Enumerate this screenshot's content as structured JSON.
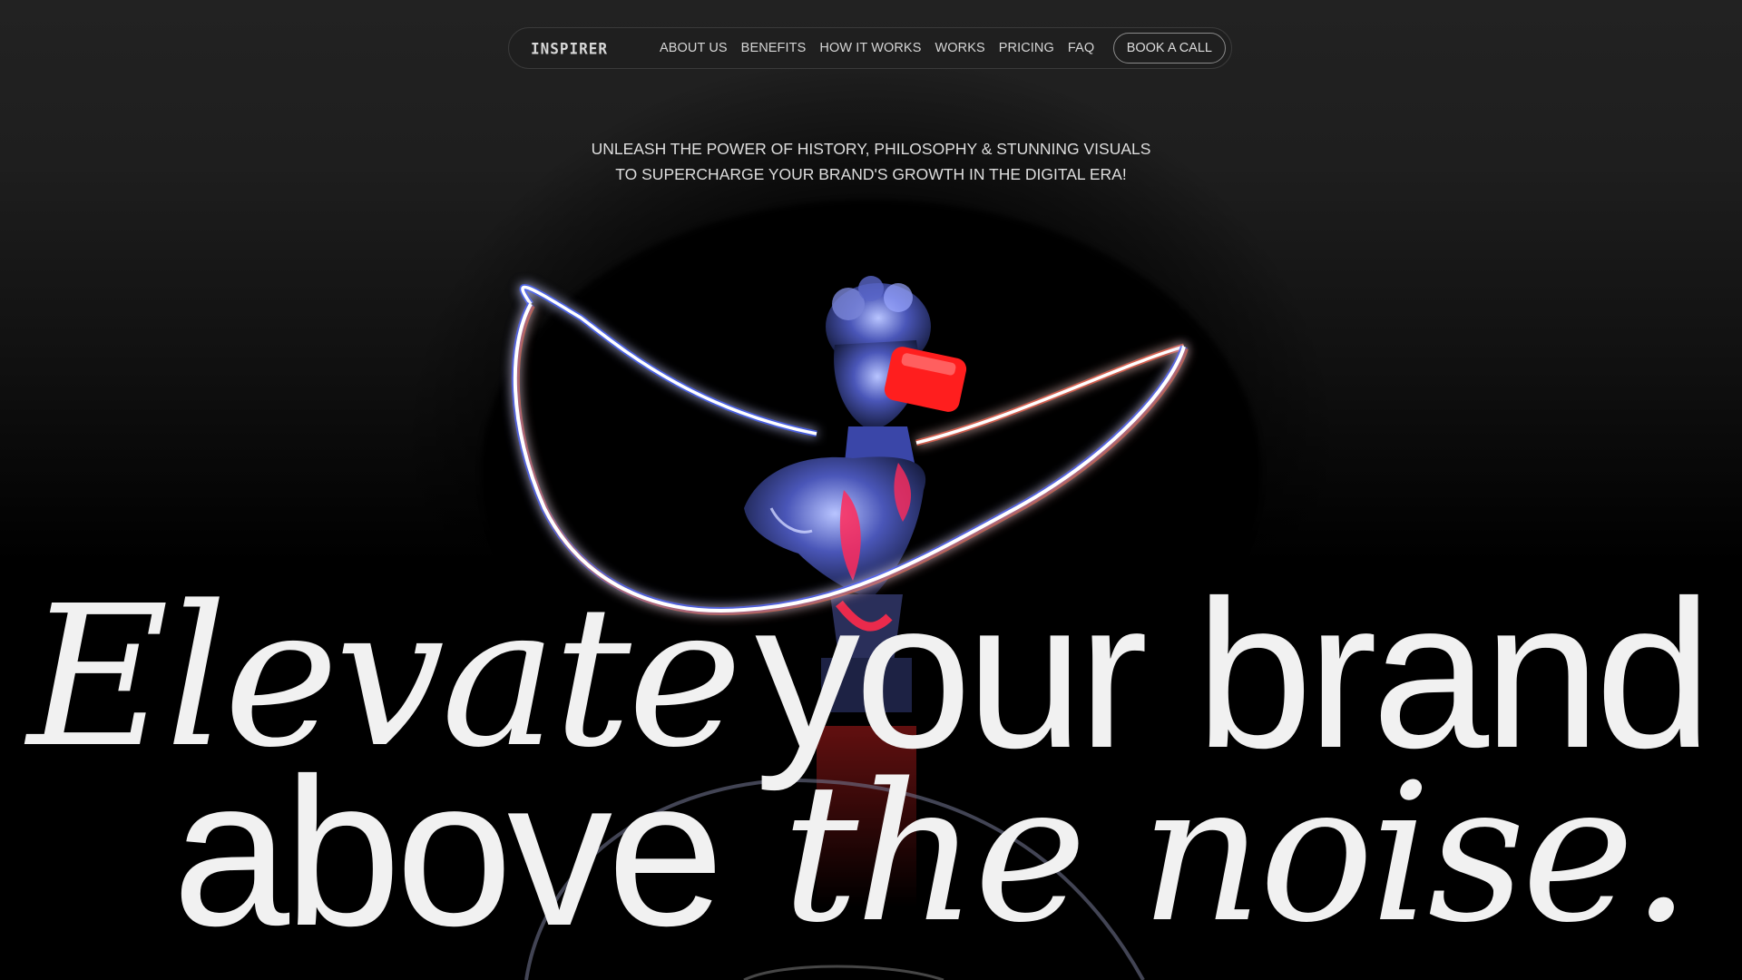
{
  "nav": {
    "logo_text": "INSPIRER",
    "links": [
      "ABOUT US",
      "BENEFITS",
      "HOW IT WORKS",
      "WORKS",
      "PRICING",
      "FAQ"
    ],
    "cta_label": "BOOK A CALL"
  },
  "hero": {
    "tagline_line1": "UNLEASH THE POWER OF HISTORY, PHILOSOPHY & STUNNING VISUALS",
    "tagline_line2": "TO SUPERCHARGE YOUR BRAND'S GROWTH IN THE DIGITAL ERA!",
    "headline_word1": "Elevate",
    "headline_word2": "your brand",
    "headline_word3": "above",
    "headline_word4": "the noise."
  },
  "colors": {
    "background": "#000000",
    "text": "#f1f1f1",
    "accent_red": "#ff2a2a",
    "neon_ring": "#ffffff"
  }
}
